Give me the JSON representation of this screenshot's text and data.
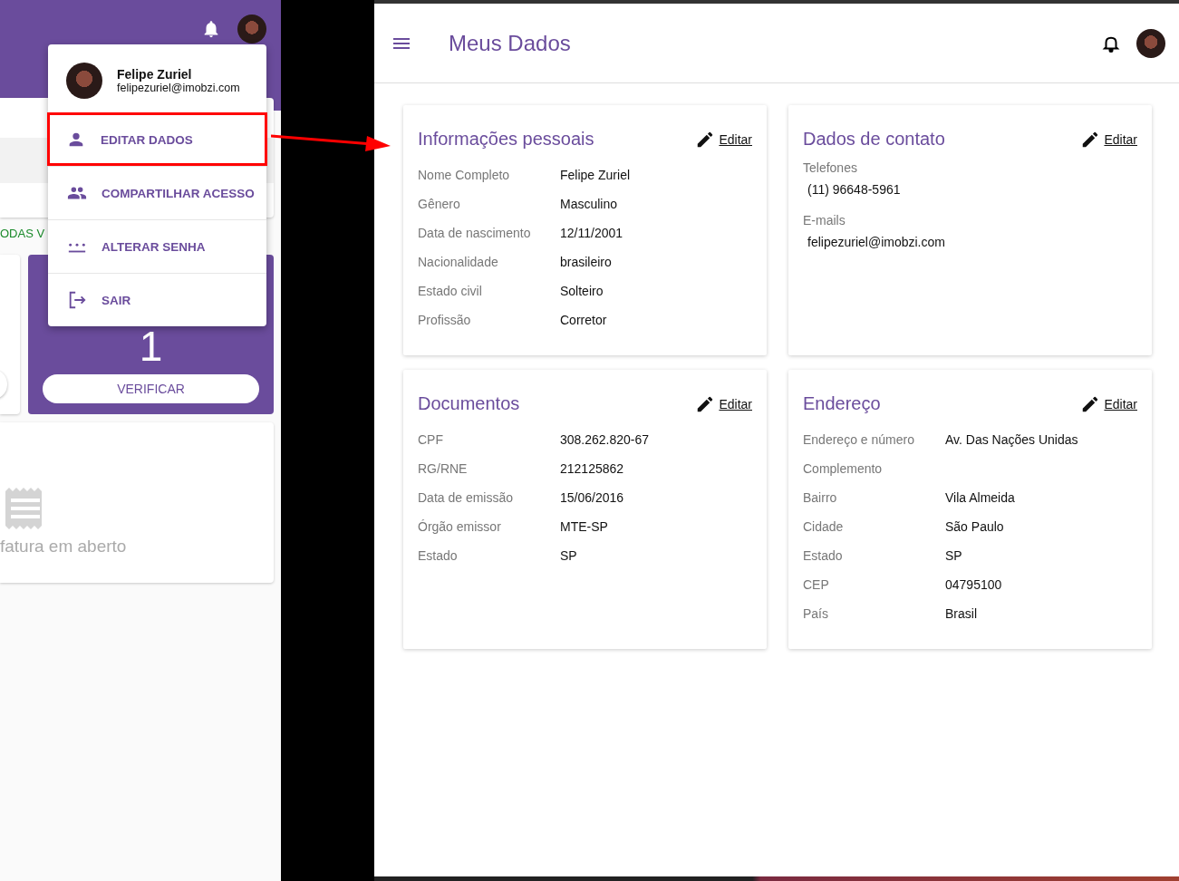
{
  "left_screen": {
    "link_fragment": "ODAS V",
    "stat_card": {
      "count": "1",
      "button": "VERIFICAR"
    },
    "invoice_card": {
      "text": "fatura em aberto"
    }
  },
  "user_menu": {
    "name": "Felipe Zuriel",
    "email": "felipezuriel@imobzi.com",
    "items": [
      {
        "label": "EDITAR DADOS",
        "kind": "person",
        "highlighted": true
      },
      {
        "label": "COMPARTILHAR ACESSO",
        "kind": "people",
        "highlighted": false
      },
      {
        "label": "ALTERAR SENHA",
        "kind": "password",
        "highlighted": false
      },
      {
        "label": "SAIR",
        "kind": "logout",
        "highlighted": false
      }
    ]
  },
  "page": {
    "title": "Meus Dados",
    "cards": [
      {
        "kind": "fields",
        "title": "Informações pessoais",
        "edit": "Editar",
        "fields": [
          {
            "label": "Nome Completo",
            "value": "Felipe Zuriel"
          },
          {
            "label": "Gênero",
            "value": "Masculino"
          },
          {
            "label": "Data de nascimento",
            "value": "12/11/2001"
          },
          {
            "label": "Nacionalidade",
            "value": "brasileiro"
          },
          {
            "label": "Estado civil",
            "value": "Solteiro"
          },
          {
            "label": "Profissão",
            "value": "Corretor"
          }
        ]
      },
      {
        "kind": "groups",
        "title": "Dados de contato",
        "edit": "Editar",
        "groups": [
          {
            "label": "Telefones",
            "values": [
              "(11) 96648-5961"
            ]
          },
          {
            "label": "E-mails",
            "values": [
              "felipezuriel@imobzi.com"
            ]
          }
        ]
      },
      {
        "kind": "fields",
        "title": "Documentos",
        "edit": "Editar",
        "fields": [
          {
            "label": "CPF",
            "value": "308.262.820-67"
          },
          {
            "label": "RG/RNE",
            "value": "212125862"
          },
          {
            "label": "Data de emissão",
            "value": "15/06/2016"
          },
          {
            "label": "Órgão emissor",
            "value": "MTE-SP"
          },
          {
            "label": "Estado",
            "value": "SP"
          }
        ]
      },
      {
        "kind": "fields",
        "title": "Endereço",
        "edit": "Editar",
        "fields": [
          {
            "label": "Endereço e número",
            "value": "Av. Das Nações Unidas"
          },
          {
            "label": "Complemento"
          },
          {
            "label": "Bairro",
            "value": "Vila Almeida"
          },
          {
            "label": "Cidade",
            "value": "São Paulo"
          },
          {
            "label": "Estado",
            "value": "SP"
          },
          {
            "label": "CEP",
            "value": "04795100"
          },
          {
            "label": "País",
            "value": "Brasil"
          }
        ]
      }
    ]
  }
}
